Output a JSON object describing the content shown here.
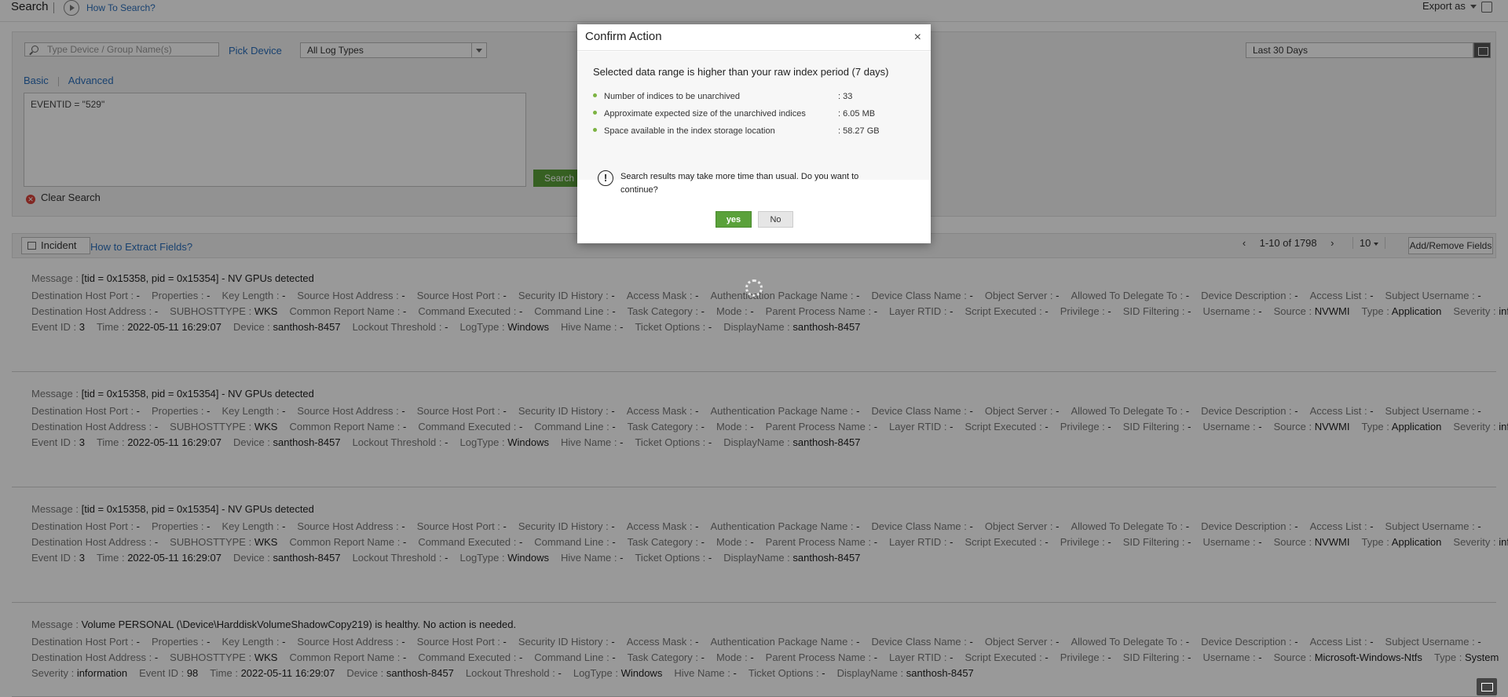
{
  "topbar": {
    "title": "Search",
    "howto": "How To Search?",
    "export_label": "Export as"
  },
  "search": {
    "device_placeholder": "Type Device / Group Name(s)",
    "pick_device": "Pick Device",
    "log_type": "All Log Types",
    "tab_basic": "Basic",
    "tab_advanced": "Advanced",
    "query": "EVENTID = \"529\"",
    "search_button": "Search",
    "clear_search": "Clear Search",
    "date_range": "Last 30 Days"
  },
  "results_toolbar": {
    "incident": "Incident",
    "extract": "How to Extract Fields?",
    "range": "1-10 of 1798",
    "per_page": "10",
    "add_remove": "Add/Remove Fields"
  },
  "entries": [
    {
      "message": "[tid = 0x15358, pid = 0x15354] - NV GPUs detected",
      "line1": [
        "Destination Host Port :",
        "Properties :",
        "Key Length :",
        "Source Host Address :",
        "Source Host Port :",
        "Security ID History :",
        "Access Mask :",
        "Authentication Package Name :",
        "Device Class Name :",
        "Object Server :",
        "Allowed To Delegate To :",
        "Device Description :",
        "Access List :",
        "Subject Username :"
      ],
      "line2": [
        [
          "Destination Host Address :",
          "-"
        ],
        [
          "SUBHOSTTYPE :",
          "WKS"
        ],
        [
          "Common Report Name :",
          "-"
        ],
        [
          "Command Executed :",
          "-"
        ],
        [
          "Command Line :",
          "-"
        ],
        [
          "Task Category :",
          "-"
        ],
        [
          "Mode :",
          "-"
        ],
        [
          "Parent Process Name :",
          "-"
        ],
        [
          "Layer RTID :",
          "-"
        ],
        [
          "Script Executed :",
          "-"
        ],
        [
          "Privilege :",
          "-"
        ],
        [
          "SID Filtering :",
          "-"
        ],
        [
          "Username :",
          "-"
        ],
        [
          "Source :",
          "NVWMI"
        ],
        [
          "Type :",
          "Application"
        ],
        [
          "Severity :",
          "information"
        ]
      ],
      "line3": [
        [
          "Event ID :",
          "3"
        ],
        [
          "Time :",
          "2022-05-11 16:29:07"
        ],
        [
          "Device :",
          "santhosh-8457"
        ],
        [
          "Lockout Threshold :",
          "-"
        ],
        [
          "LogType :",
          "Windows"
        ],
        [
          "Hive Name :",
          "-"
        ],
        [
          "Ticket Options :",
          "-"
        ],
        [
          "DisplayName :",
          "santhosh-8457"
        ]
      ]
    },
    {
      "message": "[tid = 0x15358, pid = 0x15354] - NV GPUs detected",
      "line1": [
        "Destination Host Port :",
        "Properties :",
        "Key Length :",
        "Source Host Address :",
        "Source Host Port :",
        "Security ID History :",
        "Access Mask :",
        "Authentication Package Name :",
        "Device Class Name :",
        "Object Server :",
        "Allowed To Delegate To :",
        "Device Description :",
        "Access List :",
        "Subject Username :"
      ],
      "line2": [
        [
          "Destination Host Address :",
          "-"
        ],
        [
          "SUBHOSTTYPE :",
          "WKS"
        ],
        [
          "Common Report Name :",
          "-"
        ],
        [
          "Command Executed :",
          "-"
        ],
        [
          "Command Line :",
          "-"
        ],
        [
          "Task Category :",
          "-"
        ],
        [
          "Mode :",
          "-"
        ],
        [
          "Parent Process Name :",
          "-"
        ],
        [
          "Layer RTID :",
          "-"
        ],
        [
          "Script Executed :",
          "-"
        ],
        [
          "Privilege :",
          "-"
        ],
        [
          "SID Filtering :",
          "-"
        ],
        [
          "Username :",
          "-"
        ],
        [
          "Source :",
          "NVWMI"
        ],
        [
          "Type :",
          "Application"
        ],
        [
          "Severity :",
          "information"
        ]
      ],
      "line3": [
        [
          "Event ID :",
          "3"
        ],
        [
          "Time :",
          "2022-05-11 16:29:07"
        ],
        [
          "Device :",
          "santhosh-8457"
        ],
        [
          "Lockout Threshold :",
          "-"
        ],
        [
          "LogType :",
          "Windows"
        ],
        [
          "Hive Name :",
          "-"
        ],
        [
          "Ticket Options :",
          "-"
        ],
        [
          "DisplayName :",
          "santhosh-8457"
        ]
      ]
    },
    {
      "message": "[tid = 0x15358, pid = 0x15354] - NV GPUs detected",
      "line1": [
        "Destination Host Port :",
        "Properties :",
        "Key Length :",
        "Source Host Address :",
        "Source Host Port :",
        "Security ID History :",
        "Access Mask :",
        "Authentication Package Name :",
        "Device Class Name :",
        "Object Server :",
        "Allowed To Delegate To :",
        "Device Description :",
        "Access List :",
        "Subject Username :"
      ],
      "line2": [
        [
          "Destination Host Address :",
          "-"
        ],
        [
          "SUBHOSTTYPE :",
          "WKS"
        ],
        [
          "Common Report Name :",
          "-"
        ],
        [
          "Command Executed :",
          "-"
        ],
        [
          "Command Line :",
          "-"
        ],
        [
          "Task Category :",
          "-"
        ],
        [
          "Mode :",
          "-"
        ],
        [
          "Parent Process Name :",
          "-"
        ],
        [
          "Layer RTID :",
          "-"
        ],
        [
          "Script Executed :",
          "-"
        ],
        [
          "Privilege :",
          "-"
        ],
        [
          "SID Filtering :",
          "-"
        ],
        [
          "Username :",
          "-"
        ],
        [
          "Source :",
          "NVWMI"
        ],
        [
          "Type :",
          "Application"
        ],
        [
          "Severity :",
          "information"
        ]
      ],
      "line3": [
        [
          "Event ID :",
          "3"
        ],
        [
          "Time :",
          "2022-05-11 16:29:07"
        ],
        [
          "Device :",
          "santhosh-8457"
        ],
        [
          "Lockout Threshold :",
          "-"
        ],
        [
          "LogType :",
          "Windows"
        ],
        [
          "Hive Name :",
          "-"
        ],
        [
          "Ticket Options :",
          "-"
        ],
        [
          "DisplayName :",
          "santhosh-8457"
        ]
      ]
    },
    {
      "message": "Volume PERSONAL (\\Device\\HarddiskVolumeShadowCopy219) is healthy. No action is needed.",
      "line1": [
        "Destination Host Port :",
        "Properties :",
        "Key Length :",
        "Source Host Address :",
        "Source Host Port :",
        "Security ID History :",
        "Access Mask :",
        "Authentication Package Name :",
        "Device Class Name :",
        "Object Server :",
        "Allowed To Delegate To :",
        "Device Description :",
        "Access List :",
        "Subject Username :"
      ],
      "line2": [
        [
          "Destination Host Address :",
          "-"
        ],
        [
          "SUBHOSTTYPE :",
          "WKS"
        ],
        [
          "Common Report Name :",
          "-"
        ],
        [
          "Command Executed :",
          "-"
        ],
        [
          "Command Line :",
          "-"
        ],
        [
          "Task Category :",
          "-"
        ],
        [
          "Mode :",
          "-"
        ],
        [
          "Parent Process Name :",
          "-"
        ],
        [
          "Layer RTID :",
          "-"
        ],
        [
          "Script Executed :",
          "-"
        ],
        [
          "Privilege :",
          "-"
        ],
        [
          "SID Filtering :",
          "-"
        ],
        [
          "Username :",
          "-"
        ],
        [
          "Source :",
          "Microsoft-Windows-Ntfs"
        ],
        [
          "Type :",
          "System"
        ]
      ],
      "line3": [
        [
          "Severity :",
          "information"
        ],
        [
          "Event ID :",
          "98"
        ],
        [
          "Time :",
          "2022-05-11 16:29:07"
        ],
        [
          "Device :",
          "santhosh-8457"
        ],
        [
          "Lockout Threshold :",
          "-"
        ],
        [
          "LogType :",
          "Windows"
        ],
        [
          "Hive Name :",
          "-"
        ],
        [
          "Ticket Options :",
          "-"
        ],
        [
          "DisplayName :",
          "santhosh-8457"
        ]
      ]
    }
  ],
  "modal": {
    "title": "Confirm Action",
    "lead": "Selected data range is higher than your raw index period (7 days)",
    "rows": [
      {
        "label": "Number of indices to be unarchived",
        "value": ": 33"
      },
      {
        "label": "Approximate expected size of the unarchived indices",
        "value": ": 6.05 MB"
      },
      {
        "label": "Space available in the index storage location",
        "value": ": 58.27 GB"
      }
    ],
    "warning": "Search results may take more time than usual. Do you want to continue?",
    "yes": "yes",
    "no": "No"
  }
}
